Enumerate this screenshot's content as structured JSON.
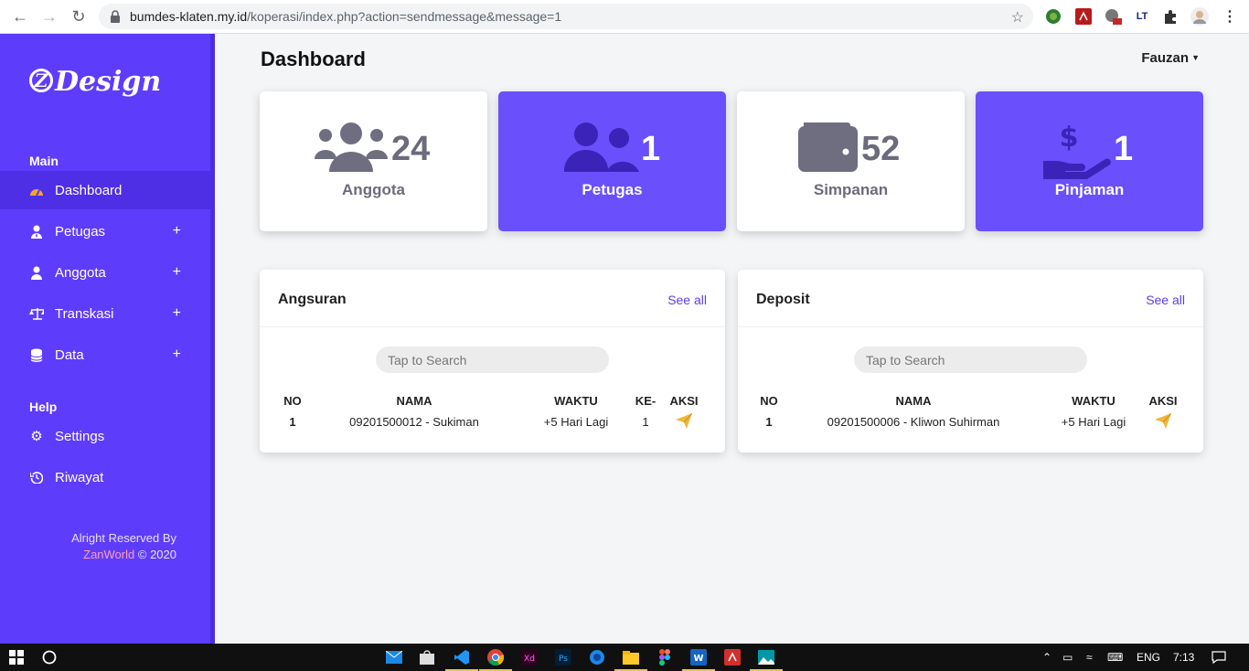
{
  "browser": {
    "url_host": "bumdes-klaten.my.id",
    "url_path": "/koperasi/index.php?action=sendmessage&message=1"
  },
  "sidebar": {
    "logo_text": "Design",
    "logo_mark": "Z",
    "main_title": "Main",
    "help_title": "Help",
    "items": [
      {
        "label": "Dashboard",
        "icon": "dashboard-icon",
        "active": true
      },
      {
        "label": "Petugas",
        "icon": "user-tie-icon",
        "expand": "+"
      },
      {
        "label": "Anggota",
        "icon": "user-icon",
        "expand": "+"
      },
      {
        "label": "Transkasi",
        "icon": "balance-scale-icon",
        "expand": "+"
      },
      {
        "label": "Data",
        "icon": "database-icon",
        "expand": "+"
      }
    ],
    "help_items": [
      {
        "label": "Settings",
        "icon": "gear-icon"
      },
      {
        "label": "Riwayat",
        "icon": "history-icon"
      }
    ],
    "footer_line1": "Alright Reserved By",
    "footer_brand": "ZanWorld",
    "footer_year": "© 2020"
  },
  "header": {
    "title": "Dashboard",
    "user": "Fauzan"
  },
  "stats": [
    {
      "label": "Anggota",
      "value": "24",
      "icon": "users-icon",
      "style": "white"
    },
    {
      "label": "Petugas",
      "value": "1",
      "icon": "user-friends-icon",
      "style": "purple"
    },
    {
      "label": "Simpanan",
      "value": "52",
      "icon": "wallet-icon",
      "style": "white"
    },
    {
      "label": "Pinjaman",
      "value": "1",
      "icon": "hand-dollar-icon",
      "style": "purple"
    }
  ],
  "angsuran": {
    "title": "Angsuran",
    "see_all": "See all",
    "search_placeholder": "Tap to Search",
    "columns": [
      "NO",
      "NAMA",
      "WAKTU",
      "KE-",
      "AKSI"
    ],
    "rows": [
      {
        "no": "1",
        "nama": "09201500012 - Sukiman",
        "waktu": "+5 Hari Lagi",
        "ke": "1"
      }
    ]
  },
  "deposit": {
    "title": "Deposit",
    "see_all": "See all",
    "search_placeholder": "Tap to Search",
    "columns": [
      "NO",
      "NAMA",
      "WAKTU",
      "AKSI"
    ],
    "rows": [
      {
        "no": "1",
        "nama": "09201500006 - Kliwon Suhirman",
        "waktu": "+5 Hari Lagi"
      }
    ]
  },
  "taskbar": {
    "lang": "ENG",
    "time": "7:13"
  },
  "colors": {
    "sidebar": "#5d3dfb",
    "card_purple": "#6a4ffd",
    "send_icon": "#f0b73a"
  }
}
